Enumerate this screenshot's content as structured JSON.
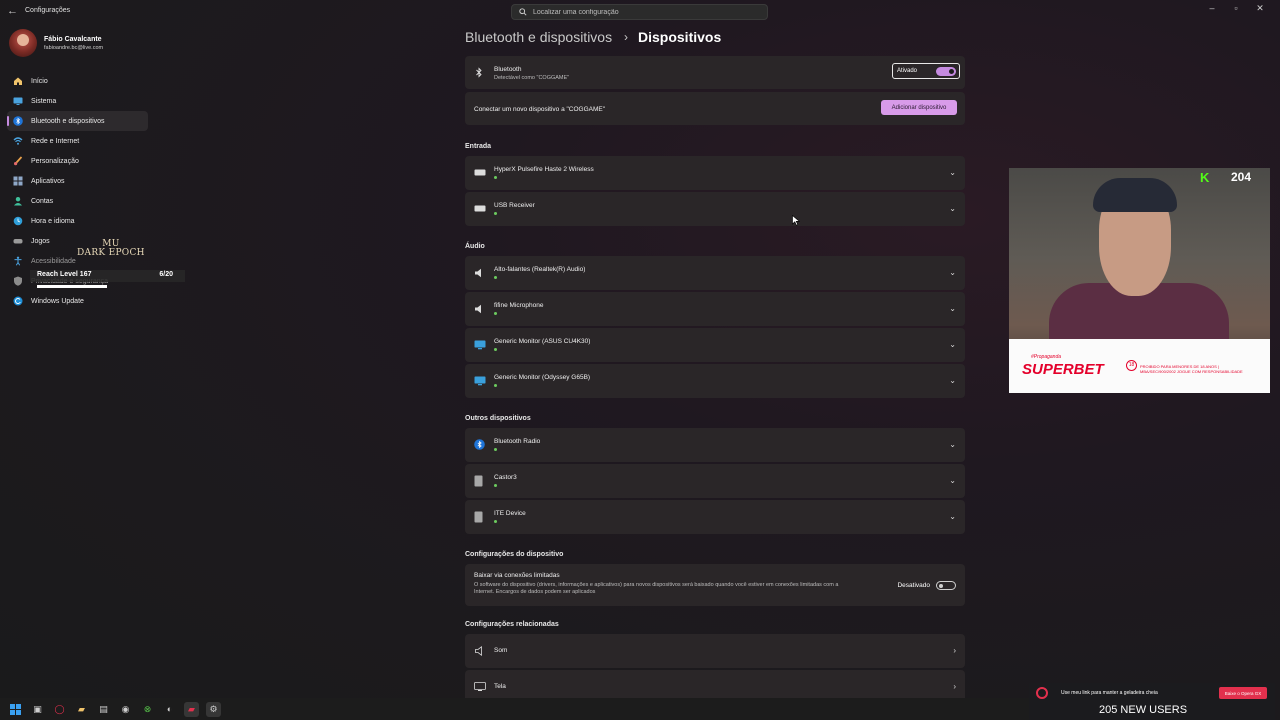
{
  "window": {
    "title": "Configurações"
  },
  "search": {
    "placeholder": "Localizar uma configuração"
  },
  "profile": {
    "name": "Fábio Cavalcante",
    "email": "fabioandre.bc@live.com"
  },
  "sidebar": {
    "items": [
      {
        "label": "Início",
        "icon": "home-icon"
      },
      {
        "label": "Sistema",
        "icon": "monitor-icon"
      },
      {
        "label": "Bluetooth e dispositivos",
        "icon": "bluetooth-icon",
        "active": true
      },
      {
        "label": "Rede e Internet",
        "icon": "wifi-icon"
      },
      {
        "label": "Personalização",
        "icon": "brush-icon"
      },
      {
        "label": "Aplicativos",
        "icon": "apps-icon"
      },
      {
        "label": "Contas",
        "icon": "person-icon"
      },
      {
        "label": "Hora e idioma",
        "icon": "globe-clock-icon"
      },
      {
        "label": "Jogos",
        "icon": "gamepad-icon"
      },
      {
        "label": "Acessibilidade",
        "icon": "accessibility-icon"
      },
      {
        "label": "Privacidade e segurança",
        "icon": "shield-icon"
      },
      {
        "label": "Windows Update",
        "icon": "update-icon"
      }
    ]
  },
  "overlay": {
    "logo_line1": "MU",
    "logo_line2": "DARK EPOCH",
    "level": "Reach Level 167",
    "count": "6/20"
  },
  "breadcrumb": {
    "parent": "Bluetooth e dispositivos",
    "separator": "›",
    "current": "Dispositivos"
  },
  "bluetooth": {
    "title": "Bluetooth",
    "subtitle": "Detectável como \"COGGAME\"",
    "toggle_label": "Ativado",
    "toggle_on": true,
    "connect_text": "Conectar um novo dispositivo a \"COGGAME\"",
    "add_button": "Adicionar dispositivo"
  },
  "sections": {
    "entrada": {
      "heading": "Entrada",
      "devices": [
        {
          "name": "HyperX Pulsefire Haste 2 Wireless",
          "icon": "mouse-icon"
        },
        {
          "name": "USB Receiver",
          "icon": "keyboard-icon"
        }
      ]
    },
    "audio": {
      "heading": "Áudio",
      "devices": [
        {
          "name": "Alto-falantes (Realtek(R) Audio)",
          "icon": "speaker-icon"
        },
        {
          "name": "fifine Microphone",
          "icon": "speaker-icon"
        },
        {
          "name": "Generic Monitor (ASUS CU4K30)",
          "icon": "monitor-icon"
        },
        {
          "name": "Generic Monitor (Odyssey G65B)",
          "icon": "monitor-icon"
        }
      ]
    },
    "outros": {
      "heading": "Outros dispositivos",
      "devices": [
        {
          "name": "Bluetooth Radio",
          "icon": "bluetooth-icon"
        },
        {
          "name": "Castor3",
          "icon": "device-icon"
        },
        {
          "name": "ITE Device",
          "icon": "device-icon"
        }
      ]
    }
  },
  "device_settings": {
    "heading": "Configurações do dispositivo",
    "metered_title": "Baixar via conexões limitadas",
    "metered_desc_1": "O software do dispositivo (drivers, informações e aplicativos) para novos dispositivos será baixado quando você estiver em conexões limitadas com a",
    "metered_desc_2": "Internet. Encargos de dados podem ser aplicados",
    "toggle_label": "Desativado",
    "toggle_on": false
  },
  "related": {
    "heading": "Configurações relacionadas",
    "items": [
      {
        "label": "Som",
        "icon": "speaker-icon"
      },
      {
        "label": "Tela",
        "icon": "monitor-icon"
      }
    ]
  },
  "webcam": {
    "kick_count": "204",
    "sponsor_tag": "#Propaganda",
    "sponsor": "SUPERBET",
    "age_badge": "18",
    "legal": "PROIBIDO PARA MENORES DE 18 ANOS | MBA/SEC/900/2002 JOGUE COM RESPONSABILIDADE"
  },
  "banner": {
    "text": "Use meu link para manter a geladeira cheia",
    "button": "Baixe o Opera GX",
    "users": "205 NEW USERS"
  },
  "colors": {
    "accent": "#c58be0",
    "status_ok": "#6ccb5f",
    "sponsor_red": "#e4002b"
  }
}
